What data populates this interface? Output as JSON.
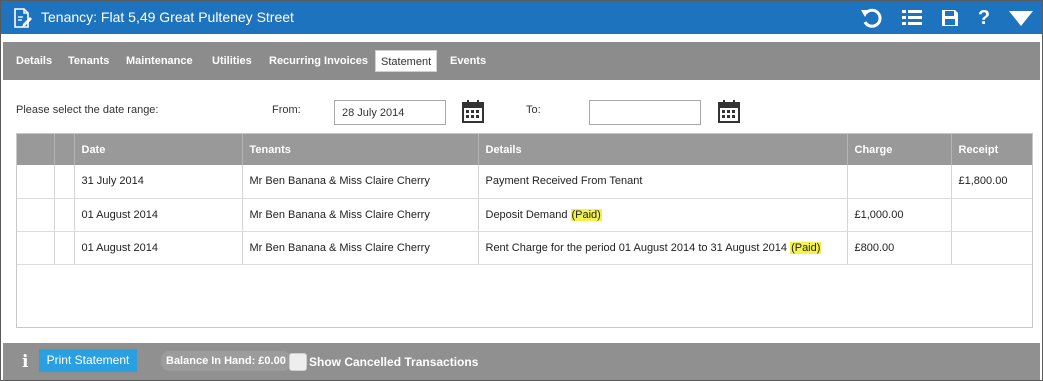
{
  "window": {
    "title": "Tenancy: Flat 5,49 Great Pulteney Street",
    "icons": {
      "document": "document-edit-icon",
      "undo": "undo-icon",
      "list": "list-icon",
      "save": "save-icon",
      "help": "help-icon",
      "menu": "dropdown-icon"
    },
    "help_glyph": "?"
  },
  "tabs": [
    {
      "label": "Details"
    },
    {
      "label": "Tenants"
    },
    {
      "label": "Maintenance"
    },
    {
      "label": "Utilities"
    },
    {
      "label": "Recurring Invoices"
    },
    {
      "label": "Statement",
      "active": true
    },
    {
      "label": "Events"
    }
  ],
  "range": {
    "prompt": "Please select the date range:",
    "from_label": "From:",
    "from_value": "28 July 2014",
    "to_label": "To:",
    "to_value": ""
  },
  "table": {
    "columns": [
      "",
      "",
      "Date",
      "Tenants",
      "Details",
      "Charge",
      "Receipt"
    ],
    "rows": [
      {
        "date": "31 July 2014",
        "tenants": "Mr Ben Banana & Miss Claire Cherry",
        "details": "Payment Received From Tenant",
        "paid": "",
        "charge": "",
        "receipt": "£1,800.00"
      },
      {
        "date": "01 August 2014",
        "tenants": "Mr Ben Banana & Miss Claire Cherry",
        "details": "Deposit Demand ",
        "paid": "(Paid)",
        "charge": "£1,000.00",
        "receipt": ""
      },
      {
        "date": "01 August 2014",
        "tenants": "Mr Ben Banana & Miss Claire Cherry",
        "details": "Rent Charge for the period 01 August 2014 to 31 August 2014 ",
        "paid": "(Paid)",
        "charge": "£800.00",
        "receipt": ""
      }
    ]
  },
  "footer": {
    "info_glyph": "i",
    "print_label": "Print Statement",
    "balance": "Balance In Hand: £0.00",
    "show_cancelled_label": "Show Cancelled Transactions",
    "show_cancelled_checked": false
  },
  "colors": {
    "title_bar": "#1e73be",
    "tabs_bar": "#8c8c8c",
    "header_row": "#999999",
    "print_button": "#2aa0e0",
    "paid_highlight": "#f3f24a"
  }
}
